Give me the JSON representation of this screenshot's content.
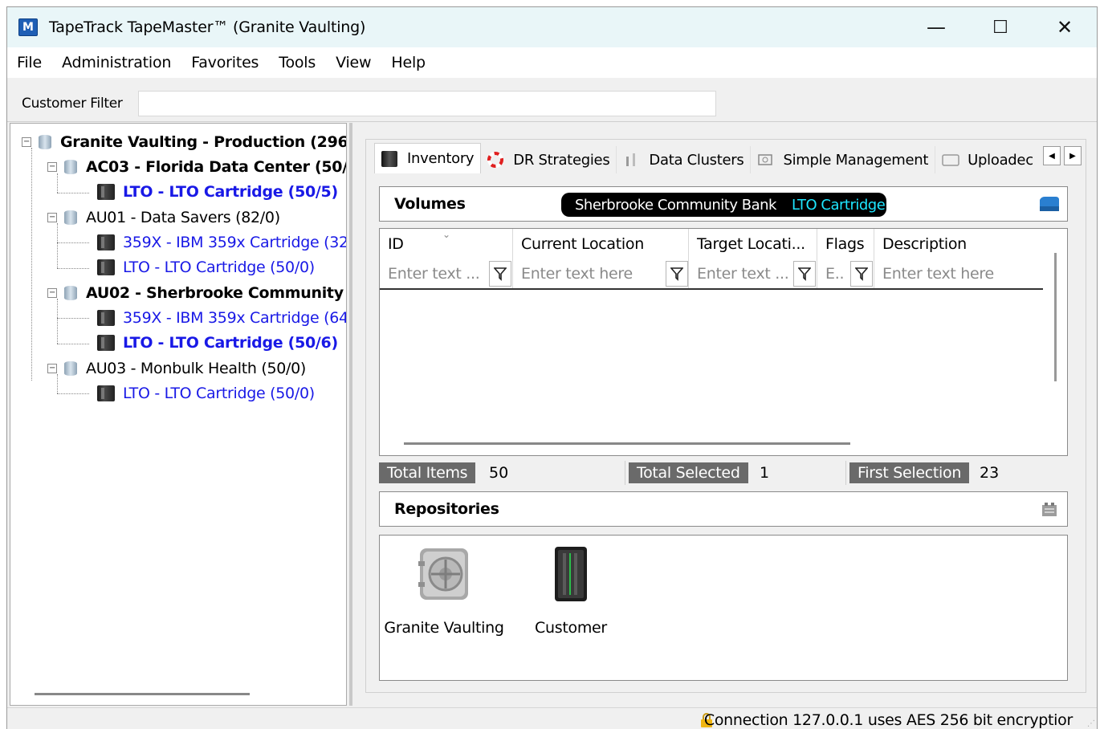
{
  "window": {
    "app_icon_letter": "M",
    "title": "TapeTrack TapeMaster™ (Granite Vaulting)",
    "controls": {
      "minimize": "—",
      "maximize": "☐",
      "close": "✕"
    }
  },
  "menu": [
    "File",
    "Administration",
    "Favorites",
    "Tools",
    "View",
    "Help"
  ],
  "customer_filter": {
    "label": "Customer Filter",
    "value": ""
  },
  "tree": [
    {
      "label": "Granite Vaulting - Production (296/",
      "bold": true,
      "link": false
    },
    {
      "label": "AC03 - Florida Data Center (50/!",
      "bold": true,
      "link": false
    },
    {
      "label": "LTO - LTO Cartridge (50/5)",
      "bold": true,
      "link": true
    },
    {
      "label": "AU01 - Data Savers (82/0)",
      "bold": false,
      "link": false
    },
    {
      "label": "359X - IBM 359x Cartridge (32,",
      "bold": false,
      "link": true
    },
    {
      "label": "LTO - LTO Cartridge (50/0)",
      "bold": false,
      "link": true
    },
    {
      "label": "AU02 - Sherbrooke Community",
      "bold": true,
      "link": false
    },
    {
      "label": "359X - IBM 359x Cartridge (64,",
      "bold": false,
      "link": true
    },
    {
      "label": "LTO - LTO Cartridge (50/6)",
      "bold": true,
      "link": true
    },
    {
      "label": "AU03 - Monbulk Health (50/0)",
      "bold": false,
      "link": false
    },
    {
      "label": "LTO - LTO Cartridge (50/0)",
      "bold": false,
      "link": true
    }
  ],
  "tabs": [
    {
      "label": "Inventory",
      "icon": "tape-icon",
      "active": true
    },
    {
      "label": "DR Strategies",
      "icon": "lifebuoy-icon",
      "active": false
    },
    {
      "label": "Data Clusters",
      "icon": "cluster-icon",
      "active": false
    },
    {
      "label": "Simple Management",
      "icon": "management-icon",
      "active": false
    },
    {
      "label": "Uploadec",
      "icon": "upload-icon",
      "active": false
    }
  ],
  "volumes": {
    "title": "Volumes",
    "customer": "Sherbrooke Community Bank",
    "media": "LTO Cartridge",
    "columns": [
      {
        "label": "ID",
        "filter_placeholder": "Enter text ..."
      },
      {
        "label": "Current Location",
        "filter_placeholder": "Enter text here"
      },
      {
        "label": "Target Locati...",
        "filter_placeholder": "Enter text ..."
      },
      {
        "label": "Flags",
        "filter_placeholder": "E.."
      },
      {
        "label": "Description",
        "filter_placeholder": "Enter text here"
      }
    ]
  },
  "stats": {
    "total_items_label": "Total Items",
    "total_items": "50",
    "total_selected_label": "Total Selected",
    "total_selected": "1",
    "first_selection_label": "First Selection",
    "first_selection": "23"
  },
  "repositories": {
    "title": "Repositories",
    "items": [
      {
        "label": "Granite Vaulting",
        "icon": "vault-icon"
      },
      {
        "label": "Customer",
        "icon": "server-icon"
      }
    ]
  },
  "status": {
    "text": "Connection 127.0.0.1 uses AES 256 bit encryptior"
  }
}
